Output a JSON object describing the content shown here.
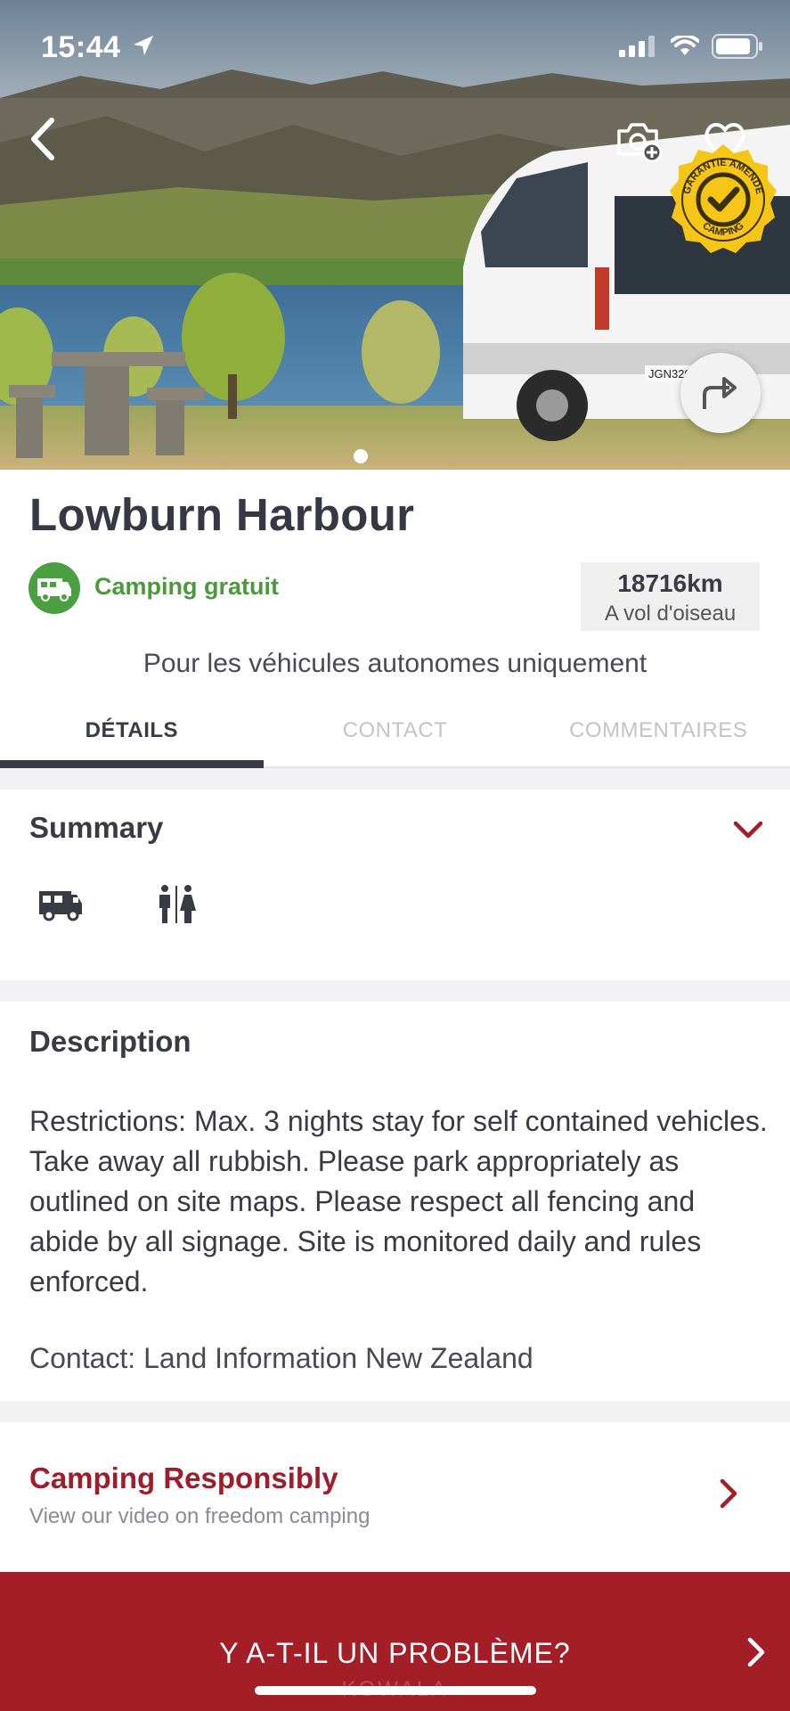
{
  "status_bar": {
    "time": "15:44",
    "icons": [
      "location-arrow-icon",
      "signal-icon",
      "wifi-icon",
      "battery-icon"
    ]
  },
  "hero": {
    "icons": [
      "back-icon",
      "add-photo-icon",
      "heart-icon",
      "share-icon"
    ],
    "badge_text": {
      "top": "GARANTIE AMENDE",
      "bottom": "CAMPING"
    },
    "van_plate": "JGN329",
    "slide_count": 1,
    "active_slide": 1
  },
  "place": {
    "name": "Lowburn Harbour",
    "category": "Camping gratuit",
    "category_icon": "campervan-icon",
    "distance_value": "18716km",
    "distance_label": "A vol d'oiseau",
    "note": "Pour les véhicules autonomes uniquement"
  },
  "tabs": [
    {
      "label": "DÉTAILS",
      "active": true
    },
    {
      "label": "CONTACT",
      "active": false
    },
    {
      "label": "COMMENTAIRES",
      "active": false
    }
  ],
  "summary": {
    "title": "Summary",
    "amenities": [
      "campervan-icon",
      "toilets-icon"
    ]
  },
  "description": {
    "title": "Description",
    "text": "Restrictions: Max. 3 nights stay for self contained vehicles. Take away all rubbish. Please park appropriately as outlined on site maps. Please respect all fencing and abide by all signage. Site is monitored daily and rules enforced.",
    "contact": "Contact: Land Information New Zealand"
  },
  "responsible": {
    "title": "Camping Responsibly",
    "subtitle": "View our video on freedom camping"
  },
  "bottom_bar": {
    "label": "Y A-T-IL UN PROBLÈME?",
    "brand": "KOWALA"
  },
  "colors": {
    "accent_red": "#a41e28",
    "title_red": "#9e1d2a",
    "green": "#4aa040",
    "text_dark": "#3a3a45",
    "badge_yellow": "#f5c518"
  }
}
